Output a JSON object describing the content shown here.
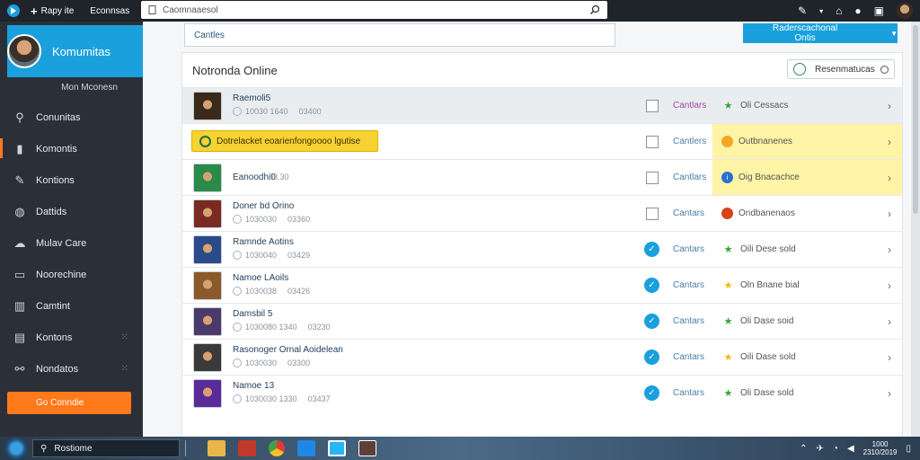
{
  "topbar": {
    "new_tab_label": "Rapy ite",
    "section_label": "Econnsas",
    "search_value": "Caomnaaesol",
    "icons": [
      "search-icon",
      "wand-icon",
      "chevron-down-icon",
      "extensions-icon",
      "account-icon",
      "window-icon",
      "avatar"
    ]
  },
  "sidebar": {
    "header_title": "Komumitas",
    "subtitle": "Mon Mconesn",
    "items": [
      {
        "label": "Conunitas",
        "icon": "search-icon",
        "active": false,
        "dots": false
      },
      {
        "label": "Komontis",
        "icon": "bookmark-icon",
        "active": true,
        "dots": false
      },
      {
        "label": "Kontions",
        "icon": "wrench-icon",
        "active": false,
        "dots": false
      },
      {
        "label": "Dattids",
        "icon": "globe-icon",
        "active": false,
        "dots": false
      },
      {
        "label": "Mulav Care",
        "icon": "cloud-icon",
        "active": false,
        "dots": false
      },
      {
        "label": "Noorechine",
        "icon": "board-icon",
        "active": false,
        "dots": false
      },
      {
        "label": "Camtint",
        "icon": "grid-icon",
        "active": false,
        "dots": false
      },
      {
        "label": "Kontons",
        "icon": "columns-icon",
        "active": false,
        "dots": true
      },
      {
        "label": "Nondatos",
        "icon": "network-icon",
        "active": false,
        "dots": true
      }
    ],
    "cta_label": "Go Conndie"
  },
  "main": {
    "filter_value": "Cantles",
    "primary_button_label": "Raderscachonal Ontis",
    "primary_button_secondary": "",
    "panel_title": "Notronda Online",
    "status_button_label": "Resenmatucas"
  },
  "rows": [
    {
      "kind": "item",
      "name": "Raemoli5",
      "meta": [
        "10030 1640",
        "03400"
      ],
      "checked": false,
      "action": "Cantlars",
      "action_purple": true,
      "stat_icon": "star-green",
      "stat_text": "Oli Cessacs",
      "stat_yellow": false,
      "selected": true,
      "thumb": "#3a2a1a"
    },
    {
      "kind": "banner",
      "banner_text": "Dotrelacket eoarienfongoooo lgutise",
      "checked": false,
      "action": "Cantlers",
      "action_purple": false,
      "stat_icon": "orange-circle",
      "stat_text": "Outbnanenes",
      "stat_yellow": true,
      "selected": false
    },
    {
      "kind": "item",
      "name": "Eanoodhi0",
      "meta": [],
      "metaval": "03.30",
      "checked": false,
      "action": "Cantlars",
      "action_purple": false,
      "stat_icon": "blue-circle",
      "stat_text": "Oig Bnacachce",
      "stat_yellow": true,
      "selected": false,
      "thumb": "#2a8a4a"
    },
    {
      "kind": "item",
      "name": "Doner bd Orino",
      "meta": [
        "1030030",
        "03360"
      ],
      "checked": false,
      "action": "Cantars",
      "action_purple": false,
      "stat_icon": "red-circle",
      "stat_text": "Ondbanenaos",
      "stat_yellow": false,
      "selected": false,
      "thumb": "#7a2a22"
    },
    {
      "kind": "item",
      "name": "Ramnde Aotins",
      "meta": [
        "1030040",
        "03429"
      ],
      "checked": true,
      "action": "Cantars",
      "action_purple": false,
      "stat_icon": "star-green",
      "stat_text": "Oili Dese sold",
      "stat_yellow": false,
      "selected": false,
      "thumb": "#2a4a8a"
    },
    {
      "kind": "item",
      "name": "Namoe LAoils",
      "meta": [
        "1030038",
        "03426"
      ],
      "checked": true,
      "action": "Cantars",
      "action_purple": false,
      "stat_icon": "star-gold",
      "stat_text": "Oln Bnane bial",
      "stat_yellow": false,
      "selected": false,
      "thumb": "#8a5a2a"
    },
    {
      "kind": "item",
      "name": "Damsbil 5",
      "meta": [
        "1030080 1340",
        "03230"
      ],
      "checked": true,
      "action": "Cantars",
      "action_purple": false,
      "stat_icon": "star-green",
      "stat_text": "Oli Dase soid",
      "stat_yellow": false,
      "selected": false,
      "thumb": "#4a3a6a"
    },
    {
      "kind": "item",
      "name": "Rasonoger Ornal Aoidelean",
      "meta": [
        "1030030",
        "03300"
      ],
      "checked": true,
      "action": "Cantars",
      "action_purple": false,
      "stat_icon": "star-gold",
      "stat_text": "Oili Dase sold",
      "stat_yellow": false,
      "selected": false,
      "thumb": "#3a3a3a"
    },
    {
      "kind": "item",
      "name": "Namoe 13",
      "meta": [
        "1030030 1330",
        "03437"
      ],
      "checked": true,
      "action": "Cantars",
      "action_purple": false,
      "stat_icon": "star-green",
      "stat_text": "Oli Dase sold",
      "stat_yellow": false,
      "selected": false,
      "thumb": "#5a2a9a"
    }
  ],
  "taskbar": {
    "search_value": "Rostiome",
    "clock_time": "1000",
    "clock_date": "2310/2019"
  },
  "colors": {
    "accent": "#1aa0dc",
    "cta": "#ff7a1a",
    "highlight": "#fff3a6"
  }
}
